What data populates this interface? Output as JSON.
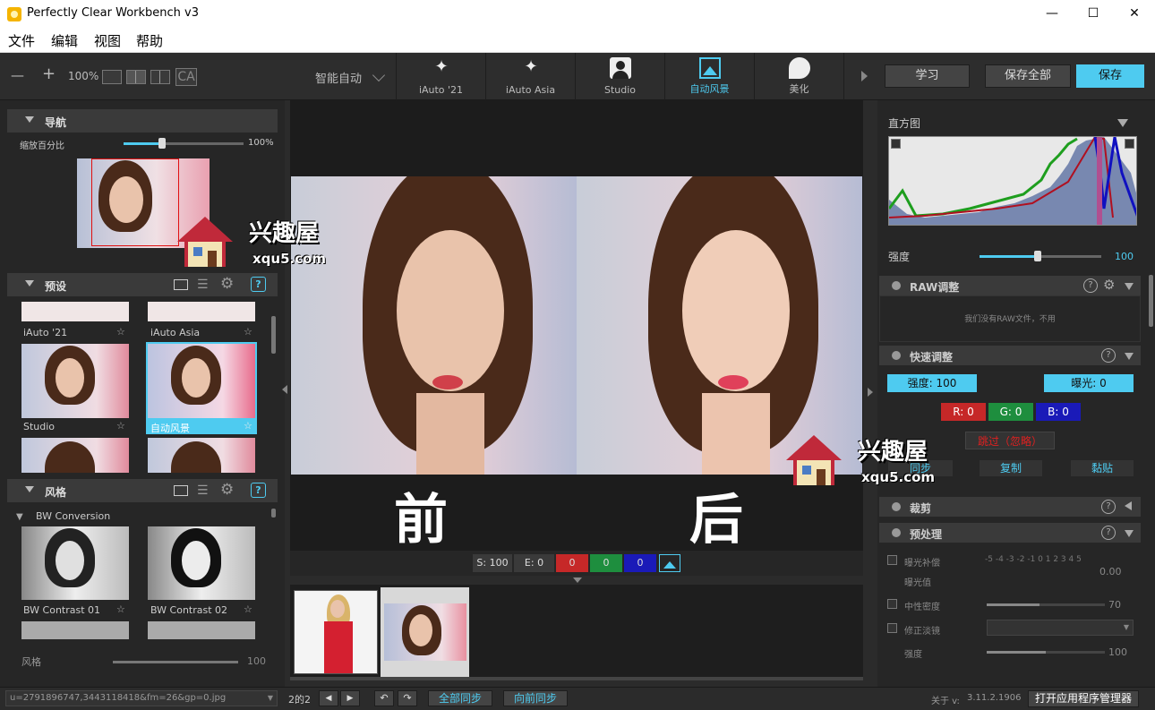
{
  "window": {
    "title": "Perfectly Clear Workbench v3",
    "min": "—",
    "max": "☐",
    "close": "✕"
  },
  "menu": [
    "文件",
    "编辑",
    "视图",
    "帮助"
  ],
  "toolbar": {
    "zoom_out": "—",
    "zoom_in": "+",
    "zoom": "100%",
    "ca": "CA",
    "smart_auto": "智能自动",
    "tabs": [
      {
        "label": "iAuto '21",
        "icon": "magic-wand-icon"
      },
      {
        "label": "iAuto Asia",
        "icon": "magic-wand-icon"
      },
      {
        "label": "Studio",
        "icon": "portrait-icon"
      },
      {
        "label": "自动风景",
        "icon": "landscape-icon"
      },
      {
        "label": "美化",
        "icon": "beauty-icon"
      }
    ],
    "learn": "学习",
    "save_all": "保存全部",
    "save": "保存"
  },
  "nav": {
    "title": "导航",
    "zoom_label": "缩放百分比",
    "zoom_value": "100%",
    "zoom_level": 0.32
  },
  "presets": {
    "title": "预设",
    "items": [
      {
        "label": "iAuto '21"
      },
      {
        "label": "iAuto Asia"
      },
      {
        "label": "Studio"
      },
      {
        "label": "自动风景"
      }
    ]
  },
  "styles": {
    "title": "风格",
    "group": "BW Conversion",
    "items": [
      {
        "label": "BW Contrast 01"
      },
      {
        "label": "BW Contrast 02"
      }
    ],
    "slider_label": "风格",
    "slider_value": "100"
  },
  "center": {
    "before": "前",
    "after": "后"
  },
  "infobar": {
    "s": "S: 100",
    "e": "E: 0",
    "r": "0",
    "g": "0",
    "b": "0"
  },
  "right": {
    "histogram": "直方图",
    "strength_label": "强度",
    "strength_value": "100",
    "strength_level": 0.48,
    "raw": {
      "title": "RAW调整",
      "msg": "我们没有RAW文件，不用"
    },
    "quick": {
      "title": "快速调整",
      "strength": "强度: 100",
      "exposure": "曝光: 0",
      "r": "R: 0",
      "g": "G: 0",
      "b": "B: 0",
      "skip": "跳过（忽略）",
      "sync": "同步",
      "copy": "复制",
      "paste": "黏贴"
    },
    "crop": {
      "title": "裁剪"
    },
    "pre": {
      "title": "预处理",
      "exp_comp": "曝光补偿",
      "exp_val": "曝光值",
      "scale": "-5 -4 -3 -2 -1 0 1 2 3 4 5",
      "exp_num": "0.00",
      "nd": "中性密度",
      "nd_val": "70",
      "nd_level": 0.45,
      "fix": "修正淡镜",
      "str": "强度",
      "str_val": "100",
      "str_level": 0.5
    }
  },
  "bottom": {
    "filename": "u=2791896747,3443118418&fm=26&gp=0.jpg",
    "pages": "2的2",
    "sync_all": "全部同步",
    "sync_fwd": "向前同步",
    "about": "关于 v:",
    "version": "3.11.2.1906",
    "app_mgr": "打开应用程序管理器"
  },
  "watermark": {
    "cn": "兴趣屋",
    "url": "xqu5.com"
  },
  "colors": {
    "accent": "#4ecbf0",
    "red": "#c62828",
    "green": "#1e8e3e",
    "blue": "#1a1ab8"
  }
}
